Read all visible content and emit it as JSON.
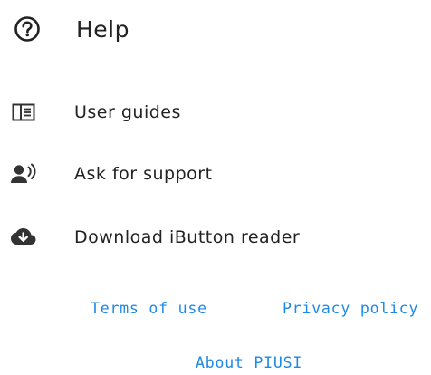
{
  "header": {
    "title": "Help",
    "icon": "help-circle-icon"
  },
  "menu": {
    "items": [
      {
        "label": "User guides",
        "icon": "book-icon"
      },
      {
        "label": "Ask for support",
        "icon": "support-agent-icon"
      },
      {
        "label": "Download iButton reader",
        "icon": "cloud-download-icon"
      }
    ]
  },
  "footer": {
    "terms": "Terms of use",
    "privacy": "Privacy policy",
    "about": "About PIUSI"
  },
  "colors": {
    "link": "#1e88e5",
    "icon": "#333333",
    "text": "#222222"
  }
}
